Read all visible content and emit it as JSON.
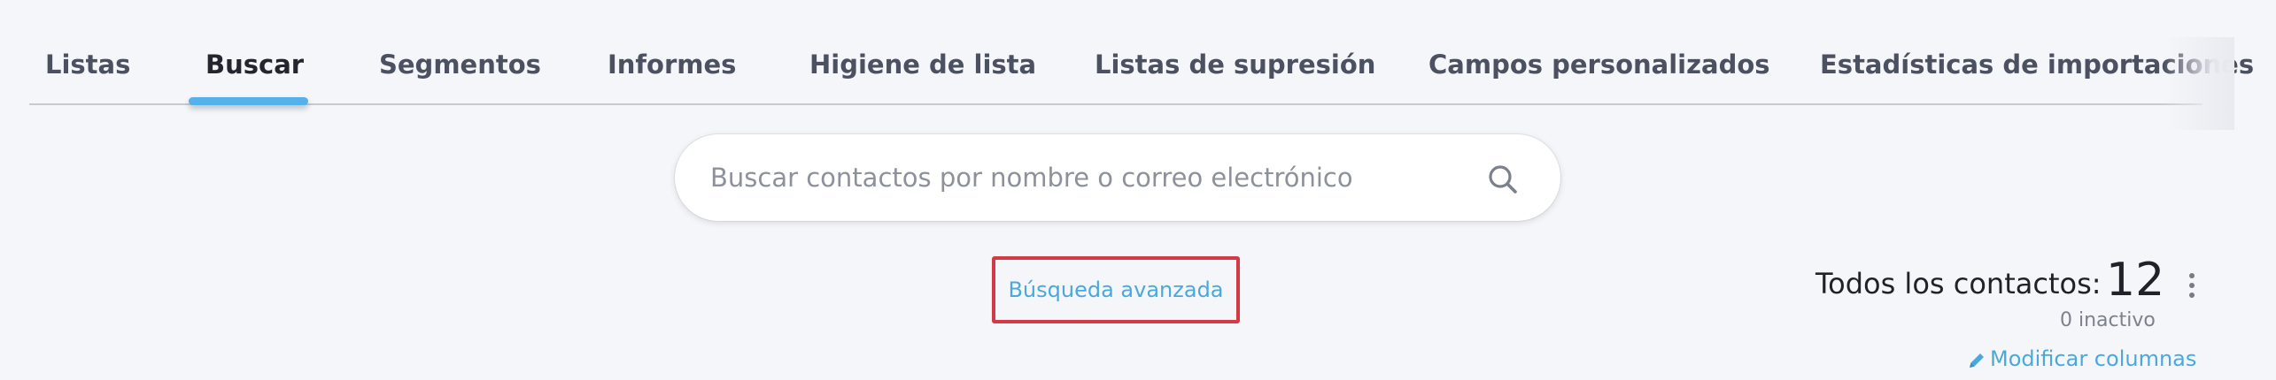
{
  "tabs": [
    {
      "label": "Listas",
      "active": false
    },
    {
      "label": "Buscar",
      "active": true
    },
    {
      "label": "Segmentos",
      "active": false
    },
    {
      "label": "Informes",
      "active": false
    },
    {
      "label": "Higiene de lista",
      "active": false
    },
    {
      "label": "Listas de supresión",
      "active": false
    },
    {
      "label": "Campos personalizados",
      "active": false
    },
    {
      "label": "Estadísticas de importaciones",
      "active": false
    }
  ],
  "search": {
    "placeholder": "Buscar contactos por nombre o correo electrónico",
    "value": "",
    "icon": "search-icon"
  },
  "advanced_search": {
    "label": "Búsqueda avanzada"
  },
  "contacts": {
    "label": "Todos los contactos:",
    "count": "12",
    "inactive": "0 inactivo",
    "modify_columns": "Modificar columnas",
    "more_icon": "more-vertical-icon",
    "edit_icon": "pencil-icon"
  },
  "colors": {
    "accent": "#55b1ea",
    "link": "#4aa9dc",
    "highlight_border": "#d33a45",
    "background": "#f5f6fa"
  }
}
